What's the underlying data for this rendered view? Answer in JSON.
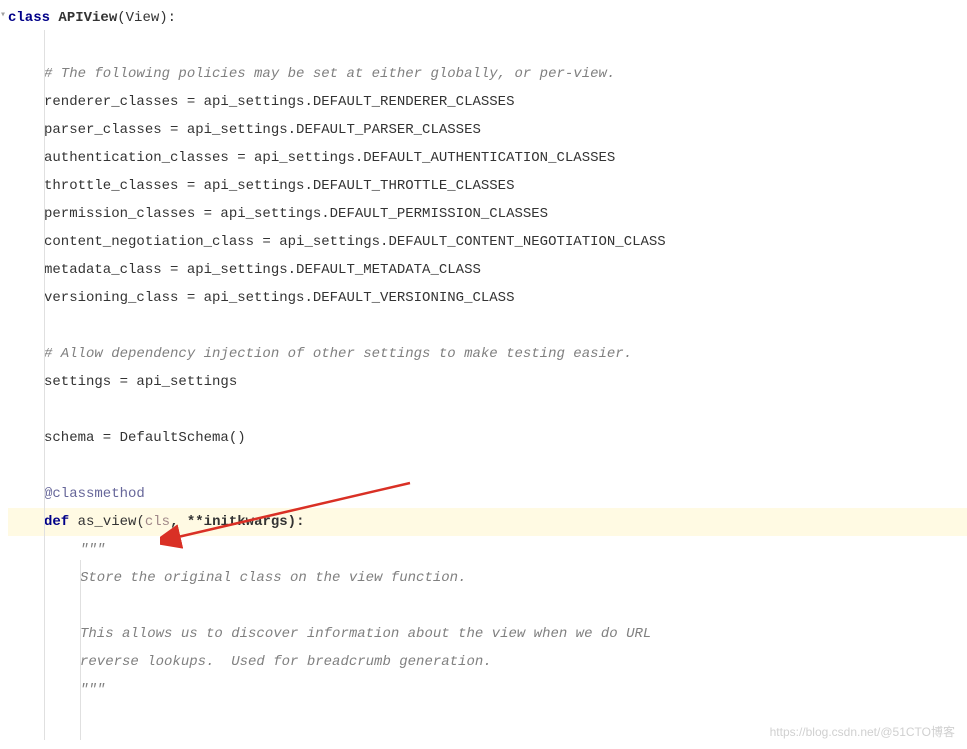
{
  "code": {
    "class_keyword": "class",
    "class_name": "APIView",
    "class_base": "(View):",
    "comment1": "# The following policies may be set at either globally, or per-view.",
    "line_renderer": "renderer_classes = api_settings.DEFAULT_RENDERER_CLASSES",
    "line_parser": "parser_classes = api_settings.DEFAULT_PARSER_CLASSES",
    "line_auth": "authentication_classes = api_settings.DEFAULT_AUTHENTICATION_CLASSES",
    "line_throttle": "throttle_classes = api_settings.DEFAULT_THROTTLE_CLASSES",
    "line_permission": "permission_classes = api_settings.DEFAULT_PERMISSION_CLASSES",
    "line_content": "content_negotiation_class = api_settings.DEFAULT_CONTENT_NEGOTIATION_CLASS",
    "line_metadata": "metadata_class = api_settings.DEFAULT_METADATA_CLASS",
    "line_versioning": "versioning_class = api_settings.DEFAULT_VERSIONING_CLASS",
    "comment2": "# Allow dependency injection of other settings to make testing easier.",
    "line_settings": "settings = api_settings",
    "line_schema": "schema = DefaultSchema()",
    "decorator": "@classmethod",
    "def_keyword": "def",
    "method_name": "as_view",
    "method_open": "(",
    "method_cls": "cls",
    "method_rest": ", **initkwargs):",
    "docstring_open": "\"\"\"",
    "docstring_line1": "Store the original class on the view function.",
    "docstring_line2": "This allows us to discover information about the view when we do URL",
    "docstring_line3": "reverse lookups.  Used for breadcrumb generation.",
    "docstring_close": "\"\"\""
  },
  "watermark": "https://blog.csdn.net/@51CTO博客",
  "arrow": {
    "color": "#d93025"
  }
}
